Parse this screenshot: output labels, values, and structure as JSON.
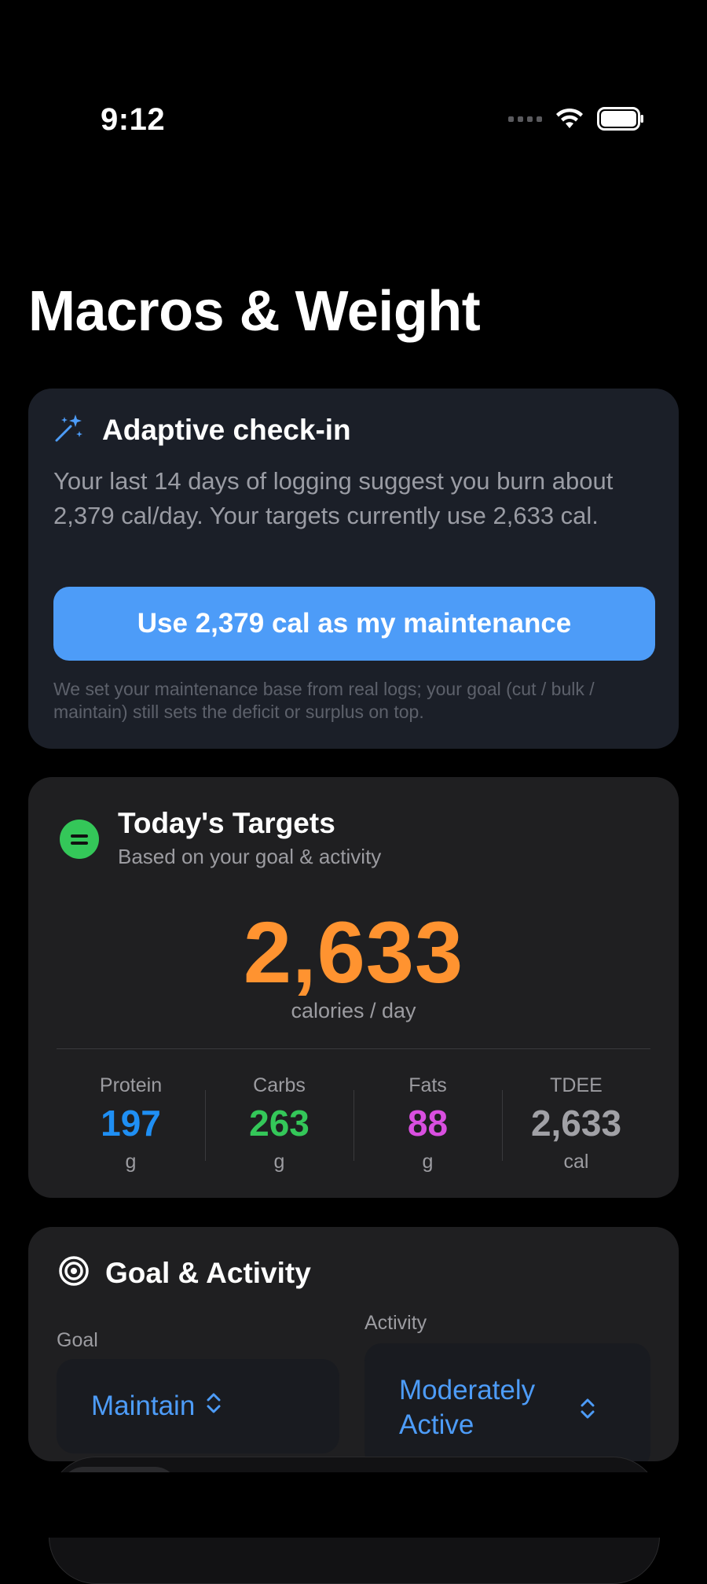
{
  "status_bar": {
    "time": "9:12"
  },
  "page_title": "Macros & Weight",
  "checkin": {
    "title": "Adaptive check-in",
    "body": "Your last 14 days of logging suggest you burn about 2,379 cal/day. Your targets currently use 2,633 cal.",
    "button_label": "Use 2,379 cal as my maintenance",
    "note": "We set your maintenance base from real logs; your goal (cut / bulk / maintain) still sets the deficit or surplus on top.",
    "icon": "magic-wand-icon"
  },
  "targets": {
    "title": "Today's Targets",
    "subtitle": "Based on your goal & activity",
    "calories": "2,633",
    "calories_unit": "calories / day",
    "macros": [
      {
        "label": "Protein",
        "value": "197",
        "unit": "g",
        "color": "#1f8ff4"
      },
      {
        "label": "Carbs",
        "value": "263",
        "unit": "g",
        "color": "#34c759"
      },
      {
        "label": "Fats",
        "value": "88",
        "unit": "g",
        "color": "#d94fe0"
      },
      {
        "label": "TDEE",
        "value": "2,633",
        "unit": "cal",
        "color": "#a1a1a6"
      }
    ],
    "accent_color": "#ff9330",
    "icon": "equal-circle-icon"
  },
  "goal_activity": {
    "title": "Goal & Activity",
    "goal_label": "Goal",
    "goal_value": "Maintain",
    "activity_label": "Activity",
    "activity_value": "Moderately Active",
    "icon": "target-icon"
  },
  "colors": {
    "background": "#000000",
    "checkin_card": "#1b1f28",
    "card": "#1f1f21",
    "accent_blue": "#4d9cf8"
  }
}
